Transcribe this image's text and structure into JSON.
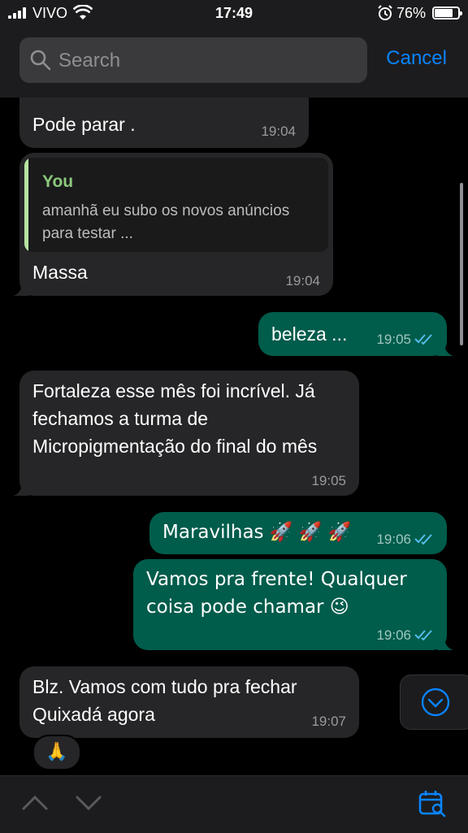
{
  "status": {
    "carrier": "VIVO",
    "time": "17:49",
    "battery": "76%"
  },
  "search": {
    "placeholder": "Search",
    "cancel_label": "Cancel"
  },
  "messages": [
    {
      "type": "in",
      "text": "Pode parar .",
      "time": "19:04"
    },
    {
      "type": "in",
      "quote_author": "You",
      "quote_text": "amanhã eu subo os novos anúncios para testar ...",
      "text": "Massa",
      "time": "19:04"
    },
    {
      "type": "out",
      "text": "beleza ...",
      "time": "19:05"
    },
    {
      "type": "in",
      "text": "Fortaleza esse mês foi incrível. Já fechamos a turma de Micropigmentação do final do mês",
      "time": "19:05"
    },
    {
      "type": "out",
      "text": "Maravilhas 🚀 🚀 🚀",
      "time": "19:06"
    },
    {
      "type": "out",
      "text": "Vamos pra frente! Qualquer coisa pode chamar 😉",
      "time": "19:06"
    },
    {
      "type": "in",
      "text": "Blz. Vamos com tudo pra fechar Quixadá agora",
      "time": "19:07",
      "reaction": "🙏"
    }
  ],
  "colors": {
    "incoming": "#262628",
    "outgoing": "#005c4b",
    "accent": "#0a84ff",
    "quote_bar": "#b6e4a2"
  },
  "icons": {
    "nav_up": "chevron-up-icon",
    "nav_down": "chevron-down-icon",
    "calendar": "calendar-search-icon",
    "scroll": "chevron-down-circle-icon"
  }
}
